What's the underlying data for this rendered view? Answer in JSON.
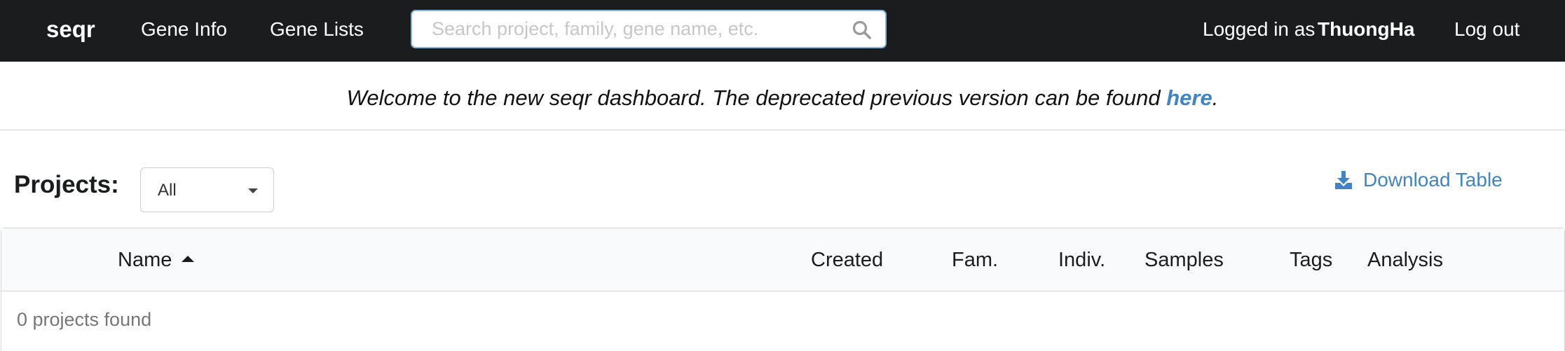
{
  "navbar": {
    "brand": "seqr",
    "links": [
      "Gene Info",
      "Gene Lists"
    ],
    "search_placeholder": "Search project, family, gene name, etc.",
    "logged_in_label": "Logged in as",
    "username": "ThuongHa",
    "logout_label": "Log out"
  },
  "banner": {
    "text": "Welcome to the new seqr dashboard. The deprecated previous version can be found ",
    "link_text": "here",
    "suffix": "."
  },
  "projects": {
    "label": "Projects:",
    "filter_value": "All",
    "download_label": "Download Table"
  },
  "table": {
    "columns": [
      "Name",
      "Created",
      "Fam.",
      "Indiv.",
      "Samples",
      "Tags",
      "Analysis"
    ],
    "sort_column": "Name",
    "sort_direction": "ascending",
    "empty_message": "0 projects found"
  },
  "colors": {
    "navbar_bg": "#1b1c1d",
    "link": "#4183c4",
    "search_border": "#85b7d9"
  }
}
